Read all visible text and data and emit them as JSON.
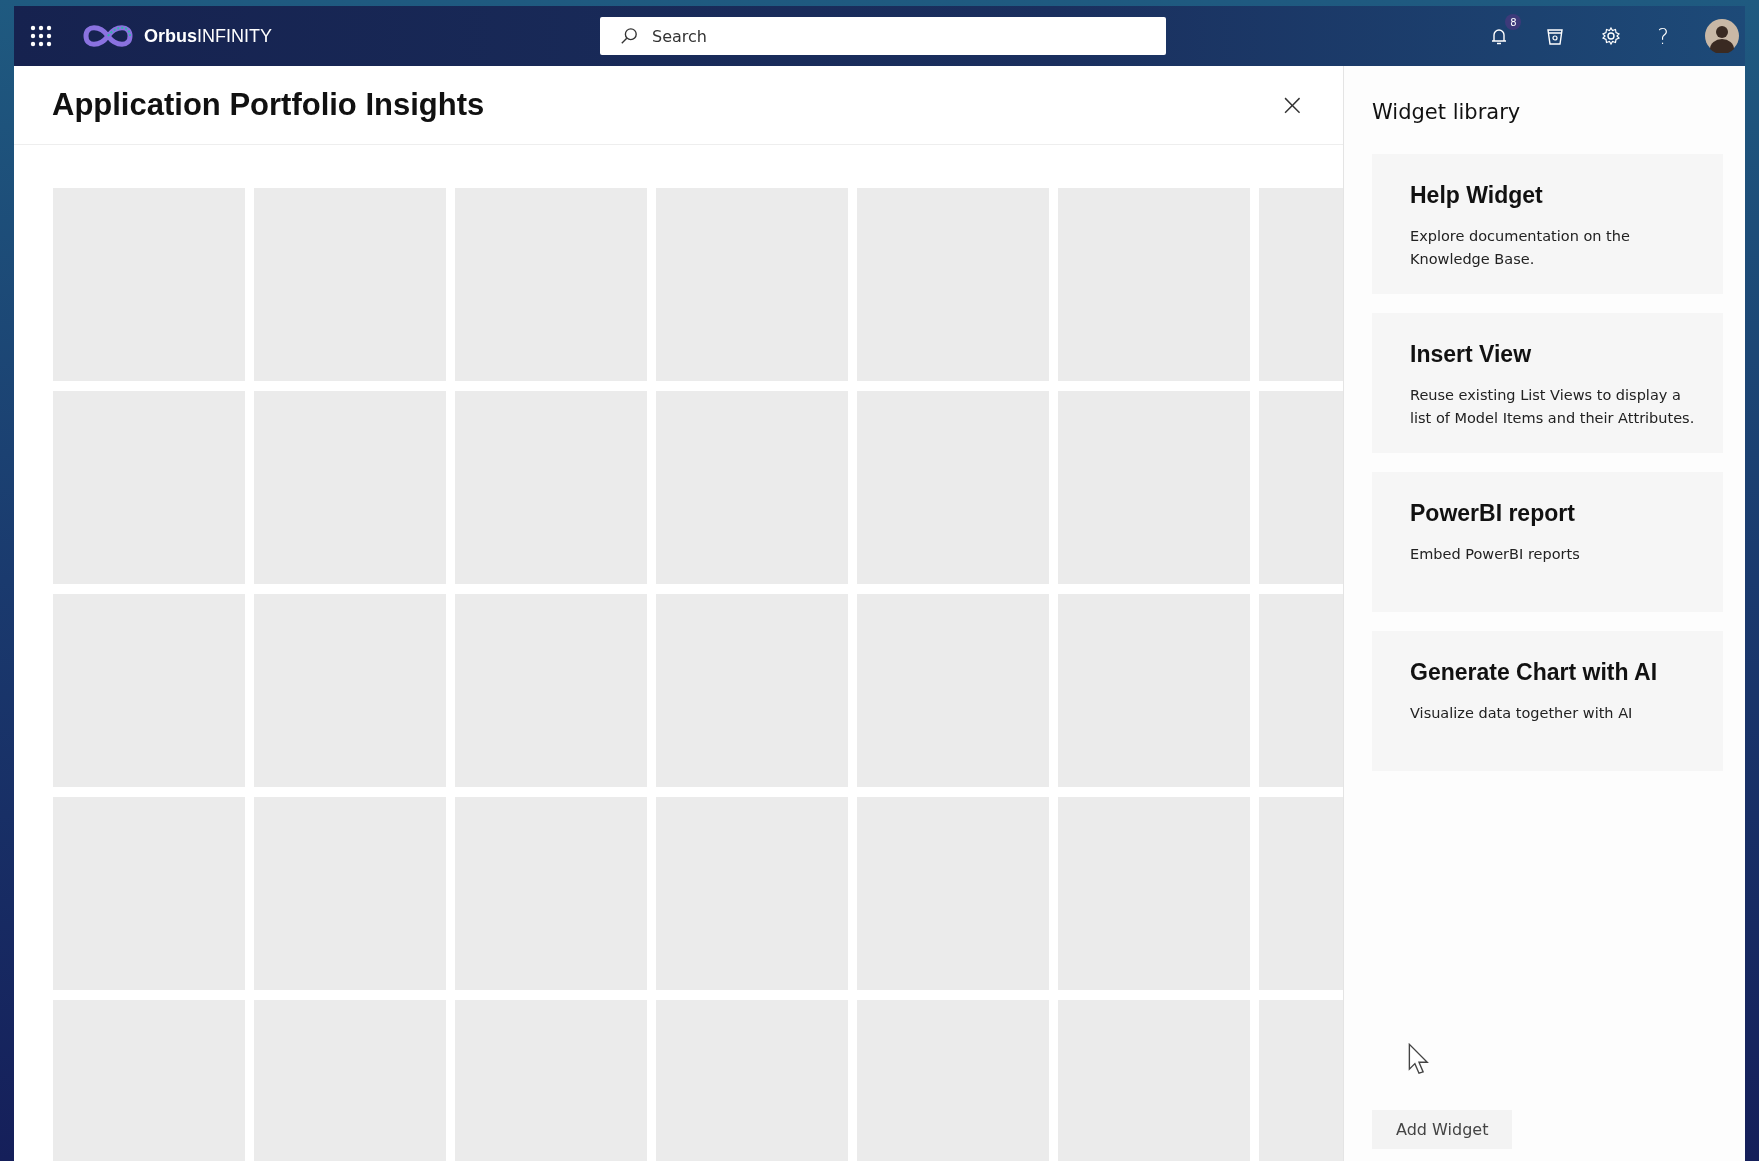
{
  "top_bar": {
    "brand_bold": "Orbus",
    "brand_light": "INFINITY",
    "search": {
      "placeholder": "Search"
    },
    "notifications": {
      "badge": "8"
    },
    "help": "?"
  },
  "page": {
    "title": "Application Portfolio Insights",
    "close": "×"
  },
  "widget_library": {
    "title": "Widget library",
    "widgets": [
      {
        "title": "Help Widget",
        "description": "Explore documentation on the Knowledge Base."
      },
      {
        "title": "Insert View",
        "description": "Reuse existing List Views to display a list of Model Items and their Attributes."
      },
      {
        "title": "PowerBI report",
        "description": "Embed PowerBI reports"
      },
      {
        "title": "Generate Chart with AI",
        "description": "Visualize data together with AI"
      }
    ],
    "add_button": "Add Widget"
  }
}
